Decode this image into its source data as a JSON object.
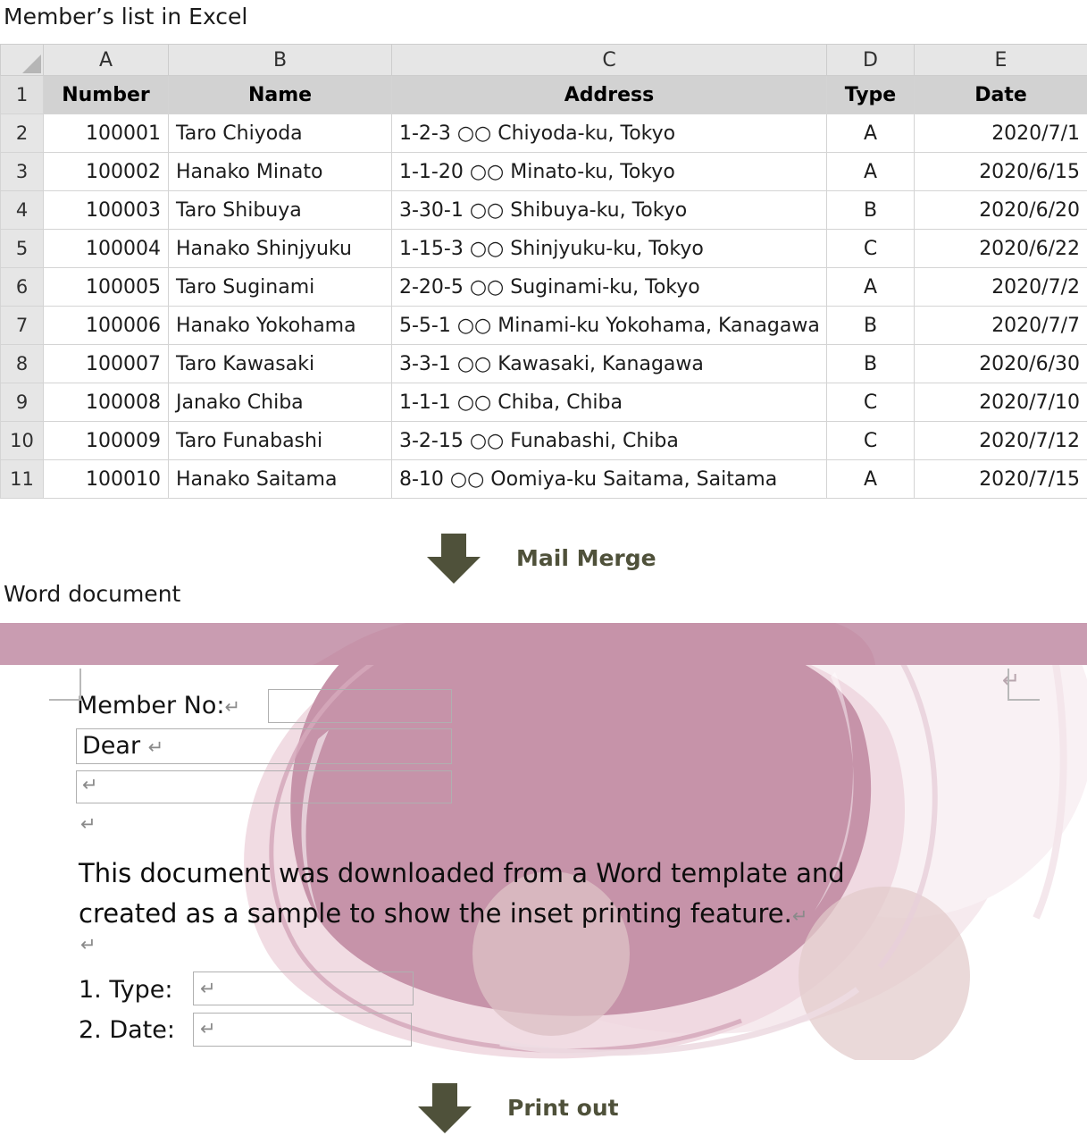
{
  "excel": {
    "caption": "Member’s list in Excel",
    "column_letters": [
      "A",
      "B",
      "C",
      "D",
      "E"
    ],
    "row_numbers": [
      "1",
      "2",
      "3",
      "4",
      "5",
      "6",
      "7",
      "8",
      "9",
      "10",
      "11"
    ],
    "headers": [
      "Number",
      "Name",
      "Address",
      "Type",
      "Date"
    ],
    "rows": [
      {
        "number": "100001",
        "name": "Taro Chiyoda",
        "address": "1-2-3  ○○ Chiyoda-ku, Tokyo",
        "type": "A",
        "date": "2020/7/1"
      },
      {
        "number": "100002",
        "name": "Hanako Minato",
        "address": "1-1-20 ○○ Minato-ku, Tokyo",
        "type": "A",
        "date": "2020/6/15"
      },
      {
        "number": "100003",
        "name": "Taro Shibuya",
        "address": "3-30-1 ○○ Shibuya-ku, Tokyo",
        "type": "B",
        "date": "2020/6/20"
      },
      {
        "number": "100004",
        "name": "Hanako Shinjyuku",
        "address": "1-15-3 ○○ Shinjyuku-ku, Tokyo",
        "type": "C",
        "date": "2020/6/22"
      },
      {
        "number": "100005",
        "name": "Taro Suginami",
        "address": "2-20-5 ○○ Suginami-ku, Tokyo",
        "type": "A",
        "date": "2020/7/2"
      },
      {
        "number": "100006",
        "name": "Hanako Yokohama",
        "address": "5-5-1 ○○ Minami-ku Yokohama, Kanagawa",
        "type": "B",
        "date": "2020/7/7"
      },
      {
        "number": "100007",
        "name": "Taro Kawasaki",
        "address": "3-3-1 ○○ Kawasaki, Kanagawa",
        "type": "B",
        "date": "2020/6/30"
      },
      {
        "number": "100008",
        "name": "Janako Chiba",
        "address": "1-1-1 ○○ Chiba, Chiba",
        "type": "C",
        "date": "2020/7/10"
      },
      {
        "number": "100009",
        "name": "Taro Funabashi",
        "address": "3-2-15 ○○ Funabashi, Chiba",
        "type": "C",
        "date": "2020/7/12"
      },
      {
        "number": "100010",
        "name": "Hanako Saitama",
        "address": "8-10 ○○ Oomiya-ku Saitama, Saitama",
        "type": "A",
        "date": "2020/7/15"
      }
    ]
  },
  "flow": {
    "mail_merge_label": "Mail Merge",
    "print_out_label": "Print out",
    "arrow_color": "#4f513a"
  },
  "word": {
    "caption": "Word document",
    "band_color": "#c99cb1",
    "member_no_label": "Member No:",
    "member_no_pilcrow": "↵",
    "dear_label": "Dear",
    "dear_pilcrow": "↵",
    "empty_line_pilcrow": "↵",
    "blank_pilcrow": "↵",
    "top_right_pilcrow": "↵",
    "body_line_1": "This document was downloaded from a Word template and",
    "body_line_2": "created as a sample to show the inset printing feature.",
    "body_pilcrow": "↵",
    "after_body_pilcrow": "↵",
    "item_1_label": "1. Type:",
    "item_1_pilcrow": "↵",
    "item_2_label": "2. Date:",
    "item_2_pilcrow": "↵"
  }
}
